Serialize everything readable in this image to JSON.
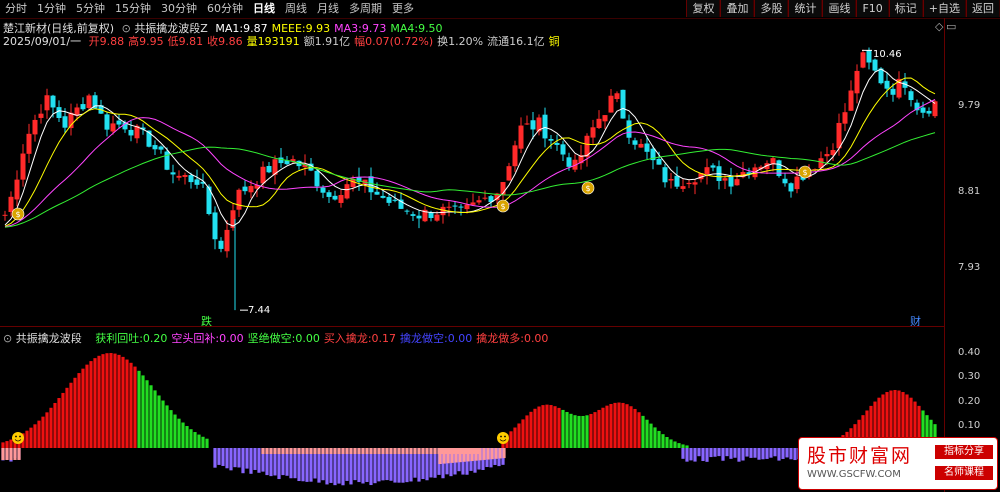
{
  "toolbar": {
    "periods": [
      "分时",
      "1分钟",
      "5分钟",
      "15分钟",
      "30分钟",
      "60分钟",
      "日线",
      "周线",
      "月线",
      "多周期",
      "更多"
    ],
    "active": "日线",
    "right_buttons": [
      "复权",
      "叠加",
      "多股",
      "统计",
      "画线",
      "F10",
      "标记",
      "+自选",
      "返回"
    ]
  },
  "header": {
    "stock": "楚江新材(日线,前复权)",
    "indicator": "共振擒龙波段Z",
    "ma": [
      {
        "label": "MA1:",
        "value": "9.87",
        "color": "#ffffff"
      },
      {
        "label": "MEEE:",
        "value": "9.93",
        "color": "#ffff00"
      },
      {
        "label": "MA3:",
        "value": "9.73",
        "color": "#ff44ff"
      },
      {
        "label": "MA4:",
        "value": "9.50",
        "color": "#44ff44"
      }
    ],
    "date": "2025/09/01/一",
    "quote": [
      {
        "label": "开",
        "value": "9.88",
        "color": "#ff4040"
      },
      {
        "label": "高",
        "value": "9.95",
        "color": "#ff4040"
      },
      {
        "label": "低",
        "value": "9.81",
        "color": "#ff4040"
      },
      {
        "label": "收",
        "value": "9.86",
        "color": "#ff4040"
      },
      {
        "label": "量",
        "value": "193191",
        "color": "#ffff00"
      },
      {
        "label": "额",
        "value": "1.91亿",
        "color": "#cccccc"
      },
      {
        "label": "幅",
        "value": "0.07(0.72%)",
        "color": "#ff4040"
      },
      {
        "label": "换",
        "value": "1.20%",
        "color": "#cccccc"
      },
      {
        "label": "流通",
        "value": "16.1亿",
        "color": "#cccccc"
      },
      {
        "label": "铜",
        "value": "",
        "color": "#ffff00"
      }
    ]
  },
  "price_axis": [
    "9.79",
    "8.81",
    "7.93"
  ],
  "annotations": {
    "high": "10.46",
    "low": "7.44",
    "die": "跌",
    "cai": "财"
  },
  "sub": {
    "title": "共振擒龙波段",
    "values": [
      {
        "label": "获利回吐:",
        "value": "0.20",
        "color": "#44ff44"
      },
      {
        "label": "空头回补:",
        "value": "0.00",
        "color": "#ff44ff"
      },
      {
        "label": "坚绝做空:",
        "value": "0.00",
        "color": "#44ff44"
      },
      {
        "label": "买入擒龙:",
        "value": "0.17",
        "color": "#ff4040"
      },
      {
        "label": "擒龙做空:",
        "value": "0.00",
        "color": "#4444ff"
      },
      {
        "label": "擒龙做多:",
        "value": "0.00",
        "color": "#ff4040"
      }
    ],
    "axis": [
      "0.40",
      "0.30",
      "0.20",
      "0.10"
    ]
  },
  "watermark": {
    "name": "股市财富网",
    "url": "WWW.GSCFW.COM",
    "tag1": "指标分享",
    "tag2": "名师课程"
  }
}
